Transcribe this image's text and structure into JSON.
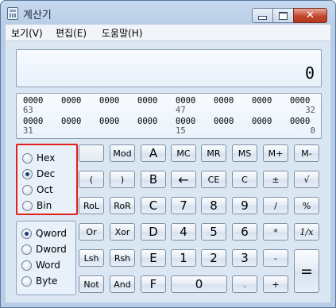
{
  "window": {
    "title": "계산기",
    "icon": "calculator-icon",
    "minimize_glyph": "minimize-icon",
    "maximize_glyph": "maximize-icon",
    "close_glyph": "✕"
  },
  "menu": {
    "items": [
      "보기(V)",
      "편집(E)",
      "도움말(H)"
    ]
  },
  "display": {
    "value": "0"
  },
  "bits": {
    "rows": [
      {
        "groups": [
          "0000",
          "0000",
          "0000",
          "0000",
          "0000",
          "0000",
          "0000",
          "0000"
        ],
        "labels": [
          "63",
          "47",
          "32"
        ]
      },
      {
        "groups": [
          "0000",
          "0000",
          "0000",
          "0000",
          "0000",
          "0000",
          "0000",
          "0000"
        ],
        "labels": [
          "31",
          "15",
          "0"
        ]
      }
    ]
  },
  "radix": {
    "options": [
      "Hex",
      "Dec",
      "Oct",
      "Bin"
    ],
    "selected": "Dec"
  },
  "word_size": {
    "options": [
      "Qword",
      "Dword",
      "Word",
      "Byte"
    ],
    "selected": "Qword"
  },
  "keys": {
    "row1": [
      "",
      "Mod",
      "A",
      "MC",
      "MR",
      "MS",
      "M+",
      "M-"
    ],
    "row2": [
      "(",
      ")",
      "B",
      "←",
      "CE",
      "C",
      "±",
      "√"
    ],
    "row3": [
      "RoL",
      "RoR",
      "C",
      "7",
      "8",
      "9",
      "/",
      "%"
    ],
    "row4": [
      "Or",
      "Xor",
      "D",
      "4",
      "5",
      "6",
      "*",
      "1/x"
    ],
    "row5": [
      "Lsh",
      "Rsh",
      "E",
      "1",
      "2",
      "3",
      "-",
      "="
    ],
    "row6": [
      "Not",
      "And",
      "F",
      "0",
      ".",
      "+"
    ]
  },
  "colors": {
    "highlight_border": "#e0201c",
    "window_frame": "#b9cde6"
  }
}
